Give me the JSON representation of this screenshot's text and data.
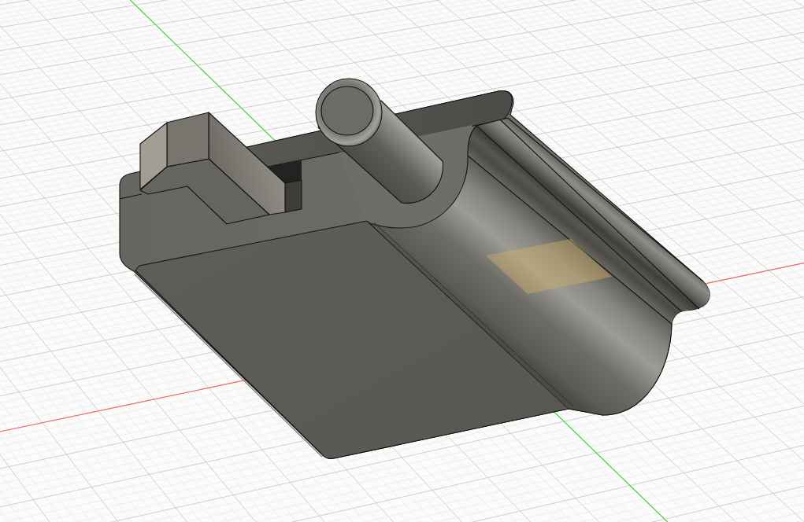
{
  "viewport": {
    "grid_visible": true,
    "axes_visible": true,
    "model": {
      "face_highlighted": true
    }
  }
}
